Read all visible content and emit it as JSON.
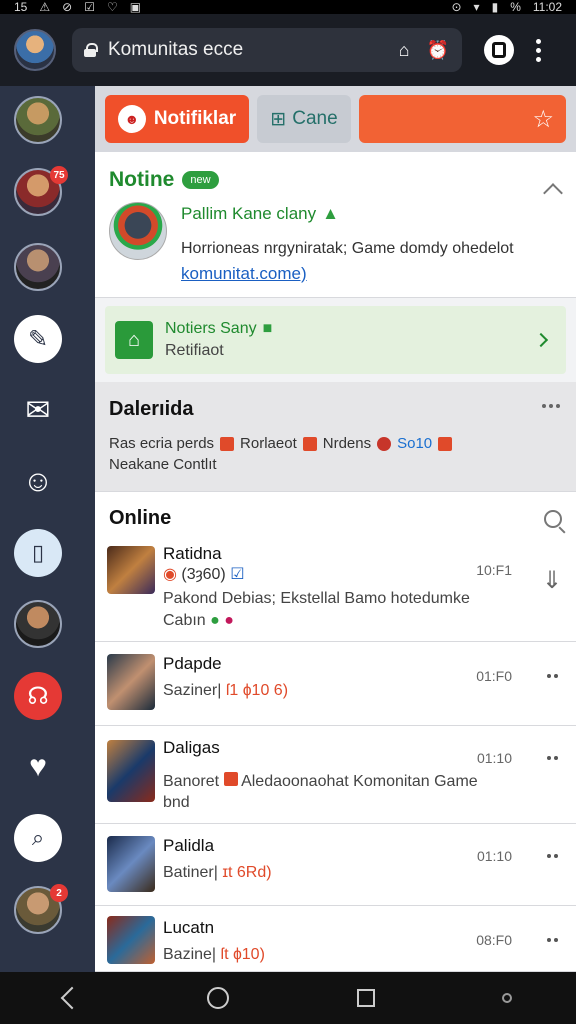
{
  "status_bar": {
    "left": [
      "15",
      "⚠",
      "⊘",
      "☑",
      "♡",
      "▣"
    ],
    "right": [
      "⊙",
      "▾",
      "▮",
      "%",
      "11:02"
    ]
  },
  "browser": {
    "url": "Komunitas  ecce"
  },
  "toolbar": {
    "notif_label": "Notifiklar",
    "game_label": "Cane"
  },
  "notice": {
    "title": "Notine",
    "badge": "new",
    "user": "Pallim Kane clany",
    "message": "Horrioneas nrgyniratak; Game domdy ohedelot",
    "link": "komunitat.come)"
  },
  "system": {
    "title": "Notiers Sany",
    "subtitle": "Retifiaot"
  },
  "category": {
    "title": "Dalerıida",
    "line1": [
      "Ras ecria perds",
      "Rorlaeot",
      "Nrdens",
      "So10"
    ],
    "line2": "Neakane Contlıt"
  },
  "online": {
    "title": "Online",
    "rows": [
      {
        "name": "Ratidna",
        "tag": "(3ȝ60)",
        "meta": "Pakond   Debias; Ekstellal Bamo hotedumke",
        "meta2": "Cabın",
        "time": "10:F1"
      },
      {
        "name": "Pdapde",
        "meta": "Saziner|",
        "stat": "ſ1 ɸ10 6)",
        "time": "01:F0"
      },
      {
        "name": "Daligas",
        "meta": "Banoret",
        "extra": "Aledaoonaohat Komonitan Game",
        "meta2": "bnd",
        "time": "01:10"
      },
      {
        "name": "Palidla",
        "meta": "Batiner|",
        "stat": "ɪt 6Rd)",
        "time": "01:10"
      },
      {
        "name": "Lucatn",
        "meta": "Bazine|",
        "stat": "ſt ɸ10)",
        "time": "08:F0"
      }
    ]
  },
  "colors": {
    "accent_orange": "#f0502a",
    "green": "#1f8a2e",
    "link_blue": "#1a5fc2",
    "rail_bg": "#2c3447"
  },
  "icons": [
    "lock-icon",
    "home-icon",
    "alarm-icon",
    "tabs-icon",
    "menu-icon",
    "star-icon",
    "chevron-up-icon",
    "check-icon",
    "search-icon",
    "download-icon",
    "back-icon",
    "home-nav-icon",
    "recents-icon"
  ]
}
